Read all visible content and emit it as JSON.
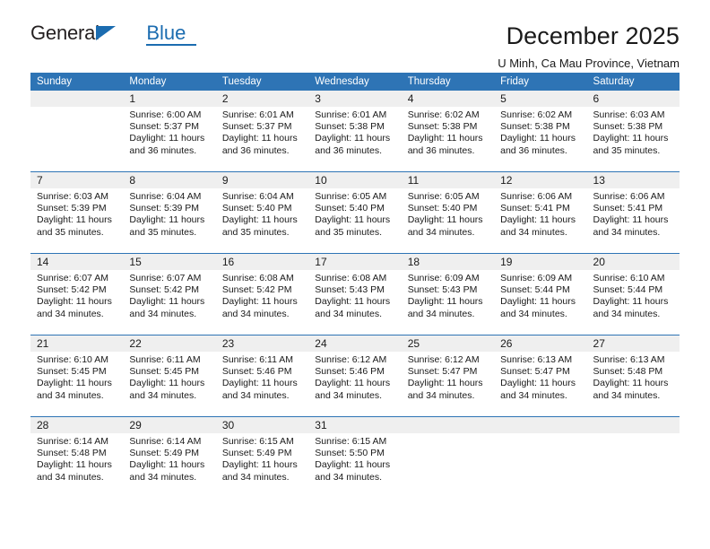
{
  "logo": {
    "word_general": "General",
    "word_blue": "Blue",
    "triangle_color": "#1b6cb0"
  },
  "header": {
    "title": "December 2025",
    "subtitle": "U Minh, Ca Mau Province, Vietnam"
  },
  "theme": {
    "header_blue": "#2e74b5",
    "daynum_gray": "#efefef",
    "text": "#1a1a1a"
  },
  "calendar": {
    "weekday_headers": [
      "Sunday",
      "Monday",
      "Tuesday",
      "Wednesday",
      "Thursday",
      "Friday",
      "Saturday"
    ],
    "weeks": [
      [
        {
          "day": "",
          "sunrise": "",
          "sunset": "",
          "daylight1": "",
          "daylight2": ""
        },
        {
          "day": "1",
          "sunrise": "Sunrise: 6:00 AM",
          "sunset": "Sunset: 5:37 PM",
          "daylight1": "Daylight: 11 hours",
          "daylight2": "and 36 minutes."
        },
        {
          "day": "2",
          "sunrise": "Sunrise: 6:01 AM",
          "sunset": "Sunset: 5:37 PM",
          "daylight1": "Daylight: 11 hours",
          "daylight2": "and 36 minutes."
        },
        {
          "day": "3",
          "sunrise": "Sunrise: 6:01 AM",
          "sunset": "Sunset: 5:38 PM",
          "daylight1": "Daylight: 11 hours",
          "daylight2": "and 36 minutes."
        },
        {
          "day": "4",
          "sunrise": "Sunrise: 6:02 AM",
          "sunset": "Sunset: 5:38 PM",
          "daylight1": "Daylight: 11 hours",
          "daylight2": "and 36 minutes."
        },
        {
          "day": "5",
          "sunrise": "Sunrise: 6:02 AM",
          "sunset": "Sunset: 5:38 PM",
          "daylight1": "Daylight: 11 hours",
          "daylight2": "and 36 minutes."
        },
        {
          "day": "6",
          "sunrise": "Sunrise: 6:03 AM",
          "sunset": "Sunset: 5:38 PM",
          "daylight1": "Daylight: 11 hours",
          "daylight2": "and 35 minutes."
        }
      ],
      [
        {
          "day": "7",
          "sunrise": "Sunrise: 6:03 AM",
          "sunset": "Sunset: 5:39 PM",
          "daylight1": "Daylight: 11 hours",
          "daylight2": "and 35 minutes."
        },
        {
          "day": "8",
          "sunrise": "Sunrise: 6:04 AM",
          "sunset": "Sunset: 5:39 PM",
          "daylight1": "Daylight: 11 hours",
          "daylight2": "and 35 minutes."
        },
        {
          "day": "9",
          "sunrise": "Sunrise: 6:04 AM",
          "sunset": "Sunset: 5:40 PM",
          "daylight1": "Daylight: 11 hours",
          "daylight2": "and 35 minutes."
        },
        {
          "day": "10",
          "sunrise": "Sunrise: 6:05 AM",
          "sunset": "Sunset: 5:40 PM",
          "daylight1": "Daylight: 11 hours",
          "daylight2": "and 35 minutes."
        },
        {
          "day": "11",
          "sunrise": "Sunrise: 6:05 AM",
          "sunset": "Sunset: 5:40 PM",
          "daylight1": "Daylight: 11 hours",
          "daylight2": "and 34 minutes."
        },
        {
          "day": "12",
          "sunrise": "Sunrise: 6:06 AM",
          "sunset": "Sunset: 5:41 PM",
          "daylight1": "Daylight: 11 hours",
          "daylight2": "and 34 minutes."
        },
        {
          "day": "13",
          "sunrise": "Sunrise: 6:06 AM",
          "sunset": "Sunset: 5:41 PM",
          "daylight1": "Daylight: 11 hours",
          "daylight2": "and 34 minutes."
        }
      ],
      [
        {
          "day": "14",
          "sunrise": "Sunrise: 6:07 AM",
          "sunset": "Sunset: 5:42 PM",
          "daylight1": "Daylight: 11 hours",
          "daylight2": "and 34 minutes."
        },
        {
          "day": "15",
          "sunrise": "Sunrise: 6:07 AM",
          "sunset": "Sunset: 5:42 PM",
          "daylight1": "Daylight: 11 hours",
          "daylight2": "and 34 minutes."
        },
        {
          "day": "16",
          "sunrise": "Sunrise: 6:08 AM",
          "sunset": "Sunset: 5:42 PM",
          "daylight1": "Daylight: 11 hours",
          "daylight2": "and 34 minutes."
        },
        {
          "day": "17",
          "sunrise": "Sunrise: 6:08 AM",
          "sunset": "Sunset: 5:43 PM",
          "daylight1": "Daylight: 11 hours",
          "daylight2": "and 34 minutes."
        },
        {
          "day": "18",
          "sunrise": "Sunrise: 6:09 AM",
          "sunset": "Sunset: 5:43 PM",
          "daylight1": "Daylight: 11 hours",
          "daylight2": "and 34 minutes."
        },
        {
          "day": "19",
          "sunrise": "Sunrise: 6:09 AM",
          "sunset": "Sunset: 5:44 PM",
          "daylight1": "Daylight: 11 hours",
          "daylight2": "and 34 minutes."
        },
        {
          "day": "20",
          "sunrise": "Sunrise: 6:10 AM",
          "sunset": "Sunset: 5:44 PM",
          "daylight1": "Daylight: 11 hours",
          "daylight2": "and 34 minutes."
        }
      ],
      [
        {
          "day": "21",
          "sunrise": "Sunrise: 6:10 AM",
          "sunset": "Sunset: 5:45 PM",
          "daylight1": "Daylight: 11 hours",
          "daylight2": "and 34 minutes."
        },
        {
          "day": "22",
          "sunrise": "Sunrise: 6:11 AM",
          "sunset": "Sunset: 5:45 PM",
          "daylight1": "Daylight: 11 hours",
          "daylight2": "and 34 minutes."
        },
        {
          "day": "23",
          "sunrise": "Sunrise: 6:11 AM",
          "sunset": "Sunset: 5:46 PM",
          "daylight1": "Daylight: 11 hours",
          "daylight2": "and 34 minutes."
        },
        {
          "day": "24",
          "sunrise": "Sunrise: 6:12 AM",
          "sunset": "Sunset: 5:46 PM",
          "daylight1": "Daylight: 11 hours",
          "daylight2": "and 34 minutes."
        },
        {
          "day": "25",
          "sunrise": "Sunrise: 6:12 AM",
          "sunset": "Sunset: 5:47 PM",
          "daylight1": "Daylight: 11 hours",
          "daylight2": "and 34 minutes."
        },
        {
          "day": "26",
          "sunrise": "Sunrise: 6:13 AM",
          "sunset": "Sunset: 5:47 PM",
          "daylight1": "Daylight: 11 hours",
          "daylight2": "and 34 minutes."
        },
        {
          "day": "27",
          "sunrise": "Sunrise: 6:13 AM",
          "sunset": "Sunset: 5:48 PM",
          "daylight1": "Daylight: 11 hours",
          "daylight2": "and 34 minutes."
        }
      ],
      [
        {
          "day": "28",
          "sunrise": "Sunrise: 6:14 AM",
          "sunset": "Sunset: 5:48 PM",
          "daylight1": "Daylight: 11 hours",
          "daylight2": "and 34 minutes."
        },
        {
          "day": "29",
          "sunrise": "Sunrise: 6:14 AM",
          "sunset": "Sunset: 5:49 PM",
          "daylight1": "Daylight: 11 hours",
          "daylight2": "and 34 minutes."
        },
        {
          "day": "30",
          "sunrise": "Sunrise: 6:15 AM",
          "sunset": "Sunset: 5:49 PM",
          "daylight1": "Daylight: 11 hours",
          "daylight2": "and 34 minutes."
        },
        {
          "day": "31",
          "sunrise": "Sunrise: 6:15 AM",
          "sunset": "Sunset: 5:50 PM",
          "daylight1": "Daylight: 11 hours",
          "daylight2": "and 34 minutes."
        },
        {
          "day": "",
          "sunrise": "",
          "sunset": "",
          "daylight1": "",
          "daylight2": ""
        },
        {
          "day": "",
          "sunrise": "",
          "sunset": "",
          "daylight1": "",
          "daylight2": ""
        },
        {
          "day": "",
          "sunrise": "",
          "sunset": "",
          "daylight1": "",
          "daylight2": ""
        }
      ]
    ]
  }
}
